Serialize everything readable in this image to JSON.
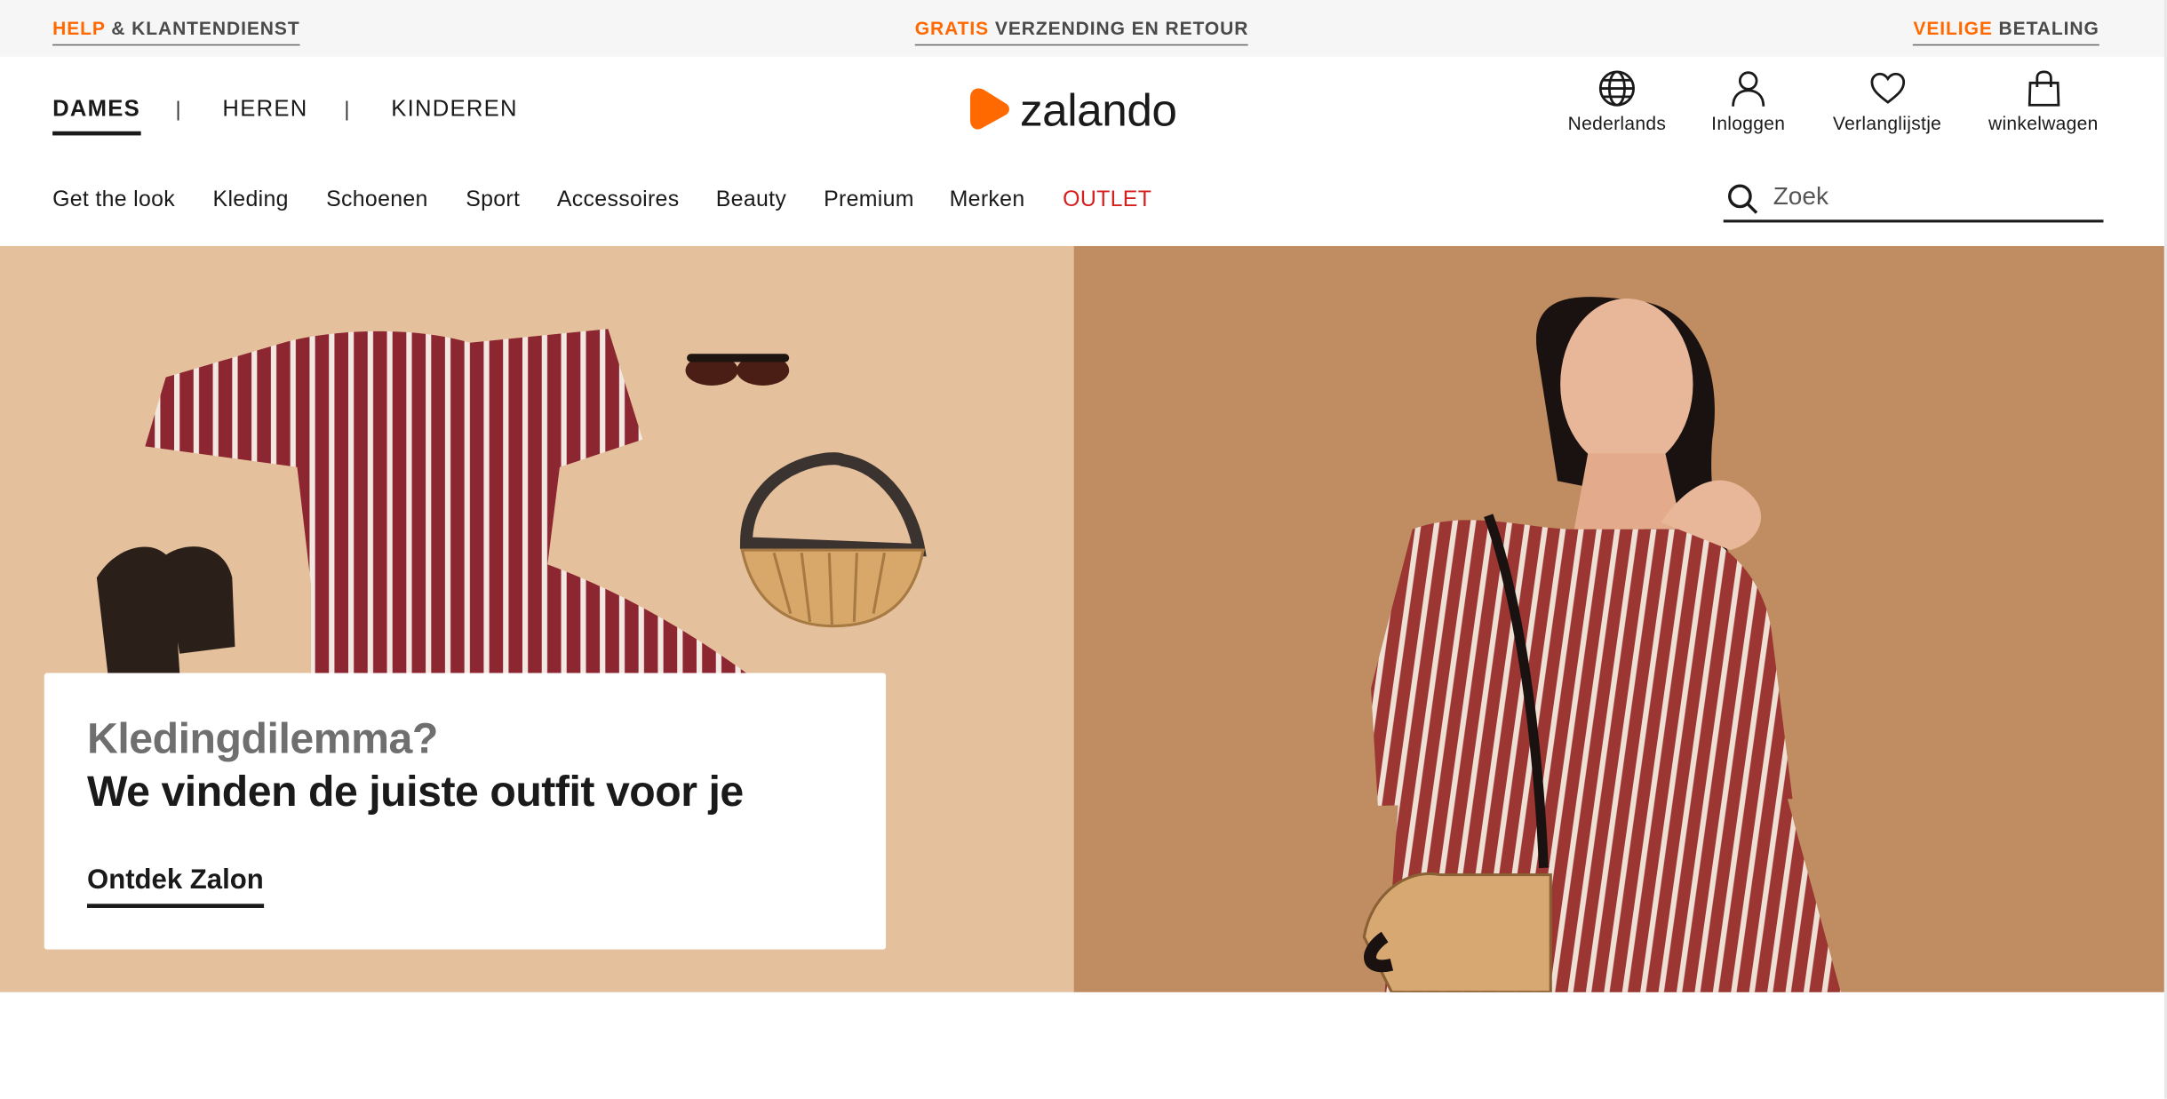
{
  "utility_bar": {
    "help": {
      "accent": "HELP",
      "rest": " & KLANTENDIENST"
    },
    "shipping": {
      "accent": "GRATIS",
      "rest": " VERZENDING EN RETOUR"
    },
    "payment": {
      "accent": "VEILIGE",
      "rest": " BETALING"
    },
    "accent_color": "#ff6900"
  },
  "gender_nav": {
    "items": [
      {
        "label": "DAMES",
        "active": true
      },
      {
        "label": "HEREN",
        "active": false
      },
      {
        "label": "KINDEREN",
        "active": false
      }
    ],
    "separator": "|"
  },
  "logo": {
    "text": "zalando",
    "brand_color": "#ff6900"
  },
  "account": {
    "language": {
      "label": "Nederlands",
      "icon": "globe-icon"
    },
    "login": {
      "label": "Inloggen",
      "icon": "user-icon"
    },
    "wishlist": {
      "label": "Verlanglijstje",
      "icon": "heart-icon"
    },
    "cart": {
      "label": "winkelwagen",
      "icon": "bag-icon"
    }
  },
  "category_nav": {
    "items": [
      "Get the look",
      "Kleding",
      "Schoenen",
      "Sport",
      "Accessoires",
      "Beauty",
      "Premium",
      "Merken",
      "OUTLET"
    ],
    "outlet_color": "#d61f1f"
  },
  "search": {
    "placeholder": "Zoek",
    "icon": "search-icon"
  },
  "hero": {
    "subtitle": "Kledingdilemma?",
    "title": "We vinden de juiste outfit voor je",
    "cta": "Ontdek Zalon"
  }
}
